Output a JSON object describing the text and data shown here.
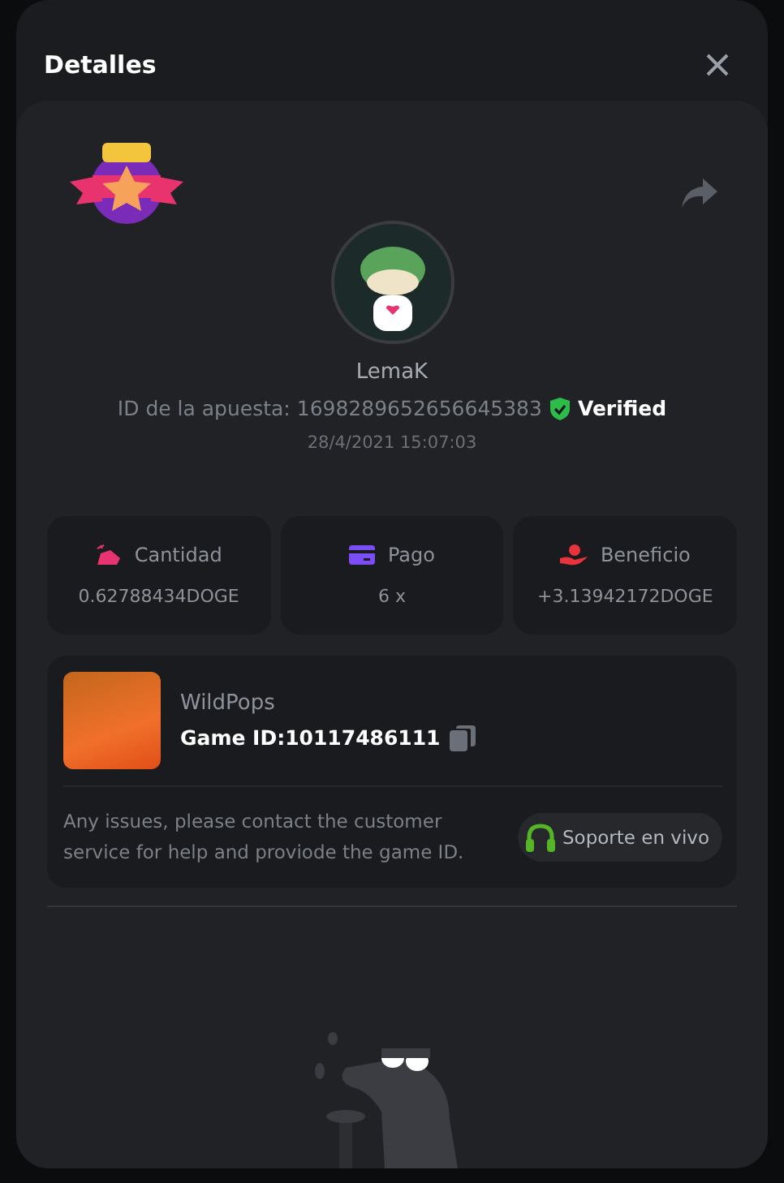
{
  "dialog": {
    "title": "Detalles"
  },
  "player": {
    "name": "LemaK",
    "bet_id_label": "ID de la apuesta: 1698289652656645383",
    "verified": "Verified",
    "datetime": "28/4/2021 15:07:03"
  },
  "stats": [
    {
      "kind": "amount",
      "label": "Cantidad",
      "value": "0.62788434DOGE",
      "color": "#e8336f"
    },
    {
      "kind": "payout",
      "label": "Pago",
      "value": "6 x",
      "color": "#7b4df5"
    },
    {
      "kind": "profit",
      "label": "Beneficio",
      "value": "+3.13942172DOGE",
      "color": "#e8333a"
    }
  ],
  "game": {
    "name": "WildPops",
    "game_id": "Game ID:10117486111",
    "help_text": "Any issues, please contact the customer service for help and proviode the game ID.",
    "support_button": "Soporte en vivo"
  }
}
